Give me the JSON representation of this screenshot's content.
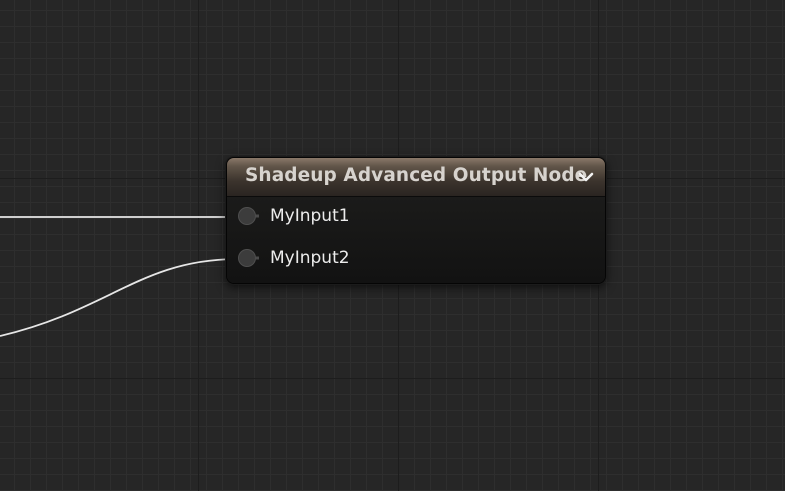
{
  "node": {
    "title": "Shadeup Advanced Output Node",
    "collapse_icon": "chevron-down-icon",
    "inputs": [
      {
        "label": "MyInput1",
        "connected": true
      },
      {
        "label": "MyInput2",
        "connected": true
      }
    ]
  },
  "colors": {
    "canvas_background": "#262626",
    "wire": "#e6e6e6",
    "header_top": "#8a7869",
    "node_body": "#141414",
    "pin_label": "#ececec"
  }
}
